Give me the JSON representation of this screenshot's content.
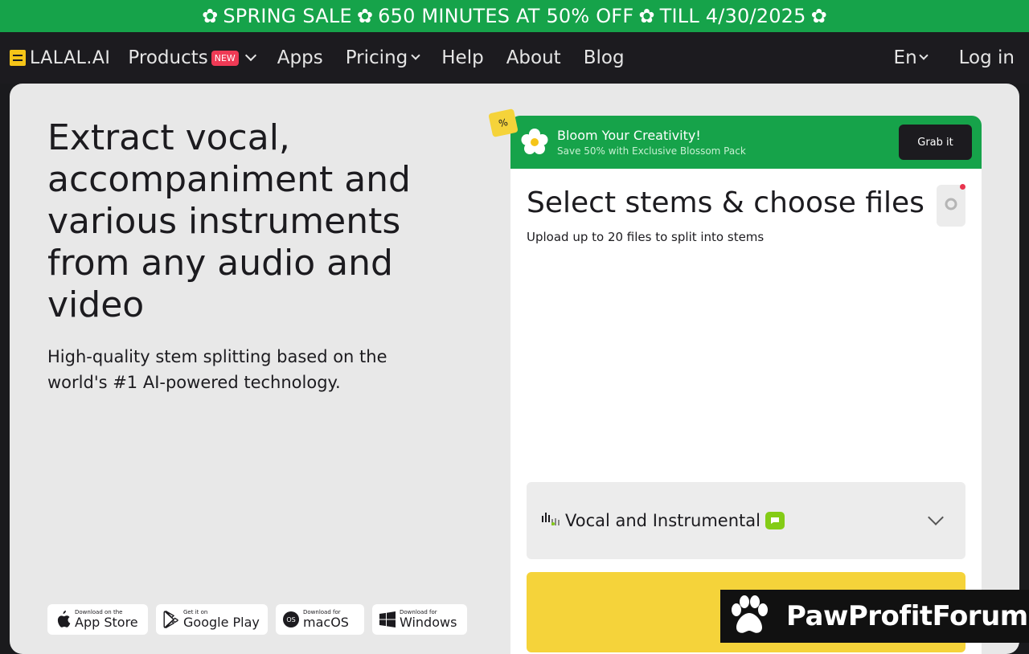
{
  "promo_bar": {
    "flower": "✿",
    "seg1": "SPRING SALE",
    "seg2": "650 MINUTES AT 50% OFF",
    "seg3": "TILL 4/30/2025"
  },
  "nav": {
    "logo": "LALAL.AI",
    "items": [
      {
        "label": "Products",
        "badge": "NEW"
      },
      {
        "label": "Apps"
      },
      {
        "label": "Pricing"
      },
      {
        "label": "Help"
      },
      {
        "label": "About"
      },
      {
        "label": "Blog"
      }
    ],
    "language": "En",
    "login": "Log in"
  },
  "hero": {
    "title": "Extract vocal, accompaniment and various instruments from any audio and video",
    "subtitle": "High-quality stem splitting based on the world's #1 AI-powered technology."
  },
  "stores": [
    {
      "small": "Download on the",
      "big": "App Store",
      "icon": "apple-icon"
    },
    {
      "small": "Get it on",
      "big": "Google Play",
      "icon": "google-play-icon"
    },
    {
      "small": "Download for",
      "big": "macOS",
      "icon": "macos-icon",
      "icon_text": "OS"
    },
    {
      "small": "Download for",
      "big": "Windows",
      "icon": "windows-icon"
    }
  ],
  "promo_banner": {
    "tag": "%",
    "title": "Bloom Your Creativity!",
    "subtitle": "Save 50% with Exclusive Blossom Pack",
    "button": "Grab it"
  },
  "panel": {
    "title": "Select stems & choose files",
    "subtitle": "Upload up to 20 files to split into stems",
    "stem_option": "Vocal and Instrumental",
    "primary_button": "Se"
  },
  "watermark": {
    "text": "PawProfitForum"
  },
  "colors": {
    "green": "#16a34a",
    "yellow": "#f5d33a",
    "dark": "#1c1b1f",
    "badge_red": "#ef3a55"
  }
}
